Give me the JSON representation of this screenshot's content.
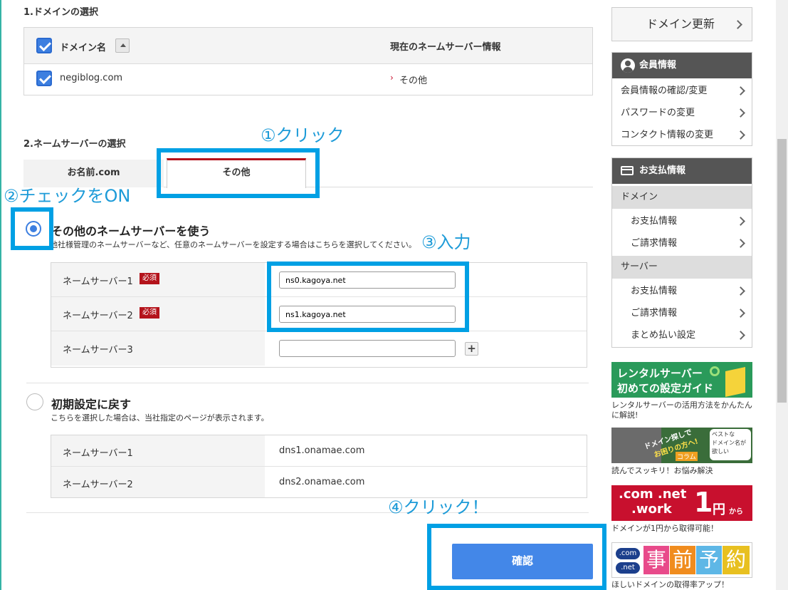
{
  "domain_section": {
    "title": "1.ドメインの選択",
    "col_domain": "ドメイン名",
    "col_ns": "現在のネームサーバー情報",
    "row_domain": "negiblog.com",
    "row_ns": "その他",
    "row_ns_arrow": "›"
  },
  "ns_section": {
    "title": "2.ネームサーバーの選択",
    "tab_onamae": "お名前.com",
    "tab_other": "その他"
  },
  "annotations": {
    "a1": "①クリック",
    "a2": "②チェックをON",
    "a3": "③入力",
    "a4": "④クリック！"
  },
  "option_other": {
    "title": "その他のネームサーバーを使う",
    "desc": "他社様管理のネームサーバーなど、任意のネームサーバーを設定する場合はこちらを選択してください。",
    "rows": [
      {
        "label": "ネームサーバー1",
        "required": "必須",
        "value": "ns0.kagoya.net"
      },
      {
        "label": "ネームサーバー2",
        "required": "必須",
        "value": "ns1.kagoya.net"
      },
      {
        "label": "ネームサーバー3",
        "value": ""
      }
    ],
    "plus": "+"
  },
  "option_default": {
    "title": "初期設定に戻す",
    "desc": "こちらを選択した場合は、当社指定のページが表示されます。",
    "rows": [
      {
        "label": "ネームサーバー1",
        "value": "dns1.onamae.com"
      },
      {
        "label": "ネームサーバー2",
        "value": "dns2.onamae.com"
      }
    ]
  },
  "confirm_label": "確認",
  "sidebar": {
    "renew": "ドメイン更新",
    "member_head": "会員情報",
    "member_items": [
      "会員情報の確認/変更",
      "パスワードの変更",
      "コンタクト情報の変更"
    ],
    "pay_head": "お支払情報",
    "cat_domain": "ドメイン",
    "domain_items": [
      "お支払情報",
      "ご請求情報"
    ],
    "cat_server": "サーバー",
    "server_items": [
      "お支払情報",
      "ご請求情報",
      "まとめ払い設定"
    ],
    "banner1_line1": "レンタルサーバー",
    "banner1_line2": "初めての設定ガイド",
    "banner1_cap": "レンタルサーバーの活用方法をかんたんに解説!",
    "banner2_l1": "ドメイン探しで",
    "banner2_l2": "お困りの方へ!",
    "banner2_tag": "コラム",
    "banner2_note1": "ベストな",
    "banner2_note2": "ドメイン名が",
    "banner2_note3": "欲しい",
    "banner2_cap": "読んでスッキリ！お悩み解決",
    "banner3_l1": ".com .net",
    "banner3_l2": ".work",
    "banner3_price": "1",
    "banner3_unit": "円",
    "banner3_kara": "から",
    "banner3_cap": "ドメインが1円から取得可能！",
    "banner4_com": ".com",
    "banner4_net": ".net",
    "banner4_chars": [
      "事",
      "前",
      "予",
      "約"
    ],
    "banner4_cap": "ほしいドメインの取得率アップ！"
  },
  "colors": {
    "accent": "#00a0e4",
    "primary_button": "#4387e8",
    "tab_active": "#b4131b",
    "required": "#b4131b"
  }
}
